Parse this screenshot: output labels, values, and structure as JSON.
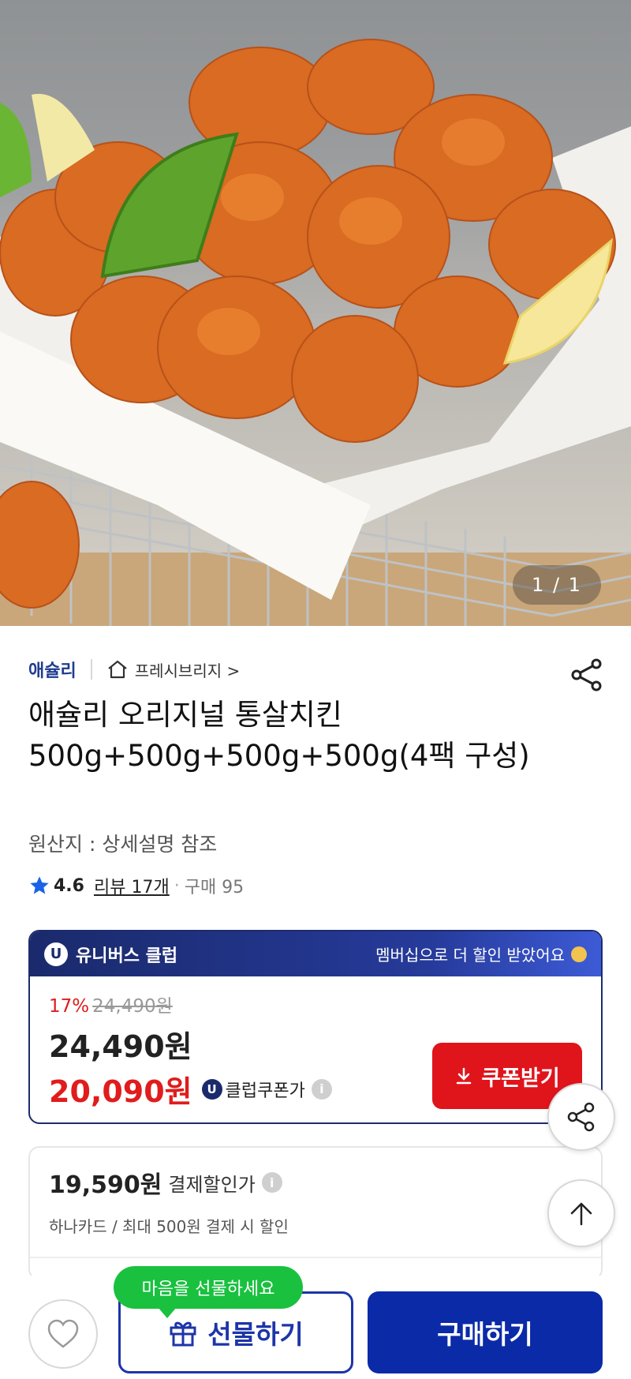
{
  "hero": {
    "image_counter": "1 / 1"
  },
  "product": {
    "seller": "애슐리",
    "store": "프레시브리지 >",
    "title": "애슐리 오리지널 통살치킨 500g+500g+500g+500g(4팩 구성)",
    "origin": "원산지 : 상세설명 참조",
    "rating": "4.6",
    "reviews": "리뷰 17개",
    "purchases": "구매 95"
  },
  "club": {
    "badge": "U",
    "name": "유니버스 클럽",
    "promo": "멤버십으로 더 할인 받았어요",
    "discount_pct": "17%",
    "original_price": "24,490원",
    "price": "24,490원",
    "coupon_price": "20,090원",
    "coupon_label": "클럽쿠폰가",
    "coupon_button": "쿠폰받기"
  },
  "payment": {
    "price": "19,590원",
    "label": "결제할인가",
    "sub": "하나카드 / 최대 500원 결제 시 할인"
  },
  "bottom": {
    "gift_tooltip": "마음을 선물하세요",
    "gift_button": "선물하기",
    "buy_button": "구매하기"
  },
  "colors": {
    "brand_blue": "#0b2aa8",
    "discount_red": "#e01c1c",
    "tooltip_green": "#19c13f",
    "club_navy": "#1a2a6c"
  }
}
